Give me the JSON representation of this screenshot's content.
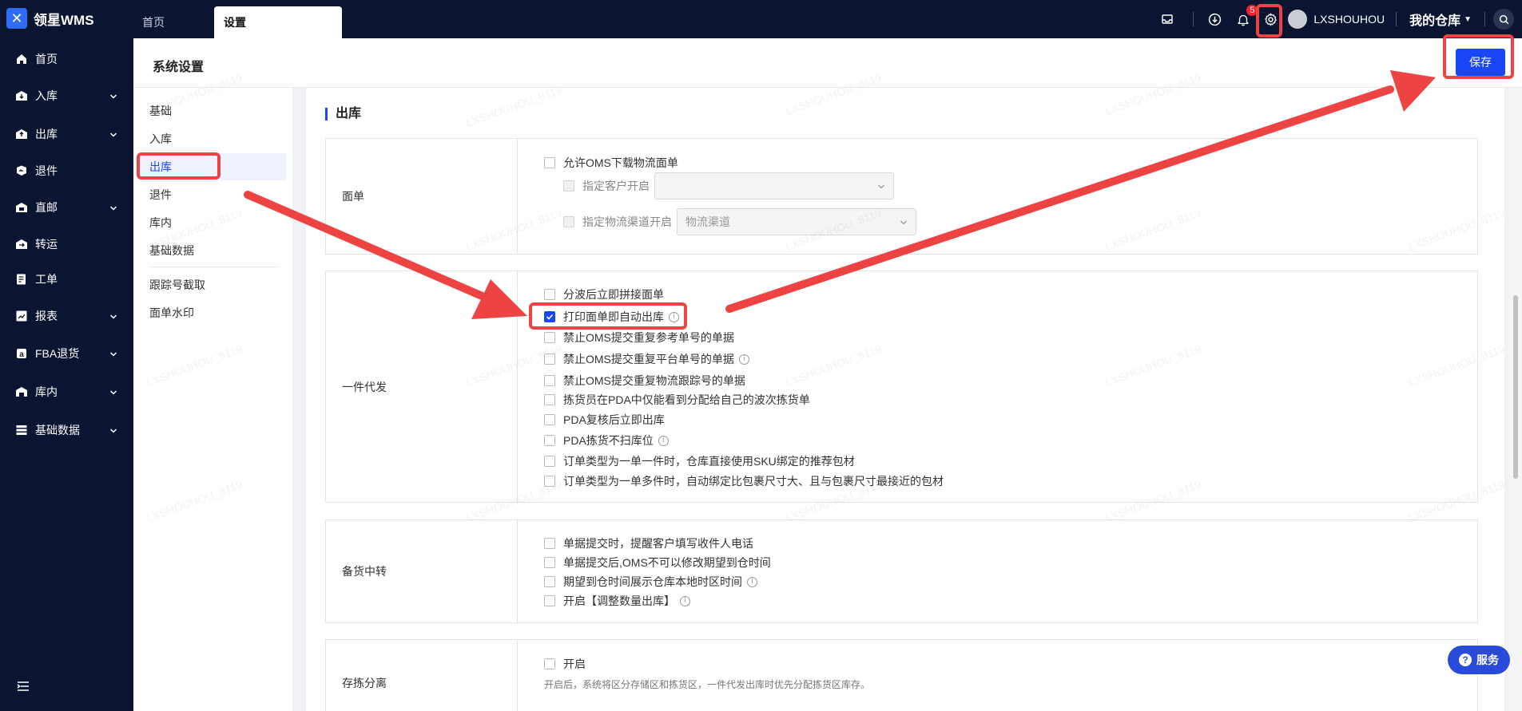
{
  "app": {
    "name": "领星WMS"
  },
  "tabs": [
    {
      "label": "首页"
    },
    {
      "label": "设置"
    }
  ],
  "topbar": {
    "notification_count": "5",
    "username": "LXSHOUHOU",
    "warehouse": "我的仓库"
  },
  "sidebar": {
    "items": [
      {
        "label": "首页",
        "icon": "home-icon"
      },
      {
        "label": "入库",
        "icon": "inbound-icon"
      },
      {
        "label": "出库",
        "icon": "outbound-icon"
      },
      {
        "label": "退件",
        "icon": "return-icon"
      },
      {
        "label": "直邮",
        "icon": "direct-mail-icon"
      },
      {
        "label": "转运",
        "icon": "transfer-icon"
      },
      {
        "label": "工单",
        "icon": "ticket-icon"
      },
      {
        "label": "报表",
        "icon": "report-icon"
      },
      {
        "label": "FBA退货",
        "icon": "amazon-icon"
      },
      {
        "label": "库内",
        "icon": "warehouse-icon"
      },
      {
        "label": "基础数据",
        "icon": "data-icon"
      }
    ]
  },
  "header": {
    "title": "系统设置",
    "save_label": "保存"
  },
  "submenu": {
    "items": [
      "基础",
      "入库",
      "出库",
      "退件",
      "库内",
      "基础数据"
    ],
    "extra": [
      "跟踪号截取",
      "面单水印"
    ],
    "active": "出库"
  },
  "content": {
    "section_title": "出库",
    "label_block": {
      "label": "面单",
      "opt_allow_oms": "允许OMS下载物流面单",
      "opt_customer": "指定客户开启",
      "opt_channel": "指定物流渠道开启",
      "channel_placeholder": "物流渠道"
    },
    "dropship_block": {
      "label": "一件代发",
      "options": [
        "分波后立即拼接面单",
        "打印面单即自动出库",
        "禁止OMS提交重复参考单号的单据",
        "禁止OMS提交重复平台单号的单据",
        "禁止OMS提交重复物流跟踪号的单据",
        "拣货员在PDA中仅能看到分配给自己的波次拣货单",
        "PDA复核后立即出库",
        "PDA拣货不扫库位",
        "订单类型为一单一件时，仓库直接使用SKU绑定的推荐包材",
        "订单类型为一单多件时，自动绑定比包裹尺寸大、且与包裹尺寸最接近的包材"
      ]
    },
    "stock_block": {
      "label": "备货中转",
      "options": [
        "单据提交时，提醒客户填写收件人电话",
        "单据提交后,OMS不可以修改期望到仓时间",
        "期望到仓时间展示仓库本地时区时间",
        "开启【调整数量出库】"
      ]
    },
    "separation_block": {
      "label": "存拣分离",
      "option": "开启",
      "hint": "开启后，系统将区分存储区和拣货区，一件代发出库时优先分配拣货区库存。"
    }
  },
  "service_label": "服务",
  "watermark_text": "LXSHOUHOU_8119",
  "colors": {
    "primary": "#1a47f5",
    "nav_bg": "#0b1532",
    "annotation": "#ee4343"
  }
}
